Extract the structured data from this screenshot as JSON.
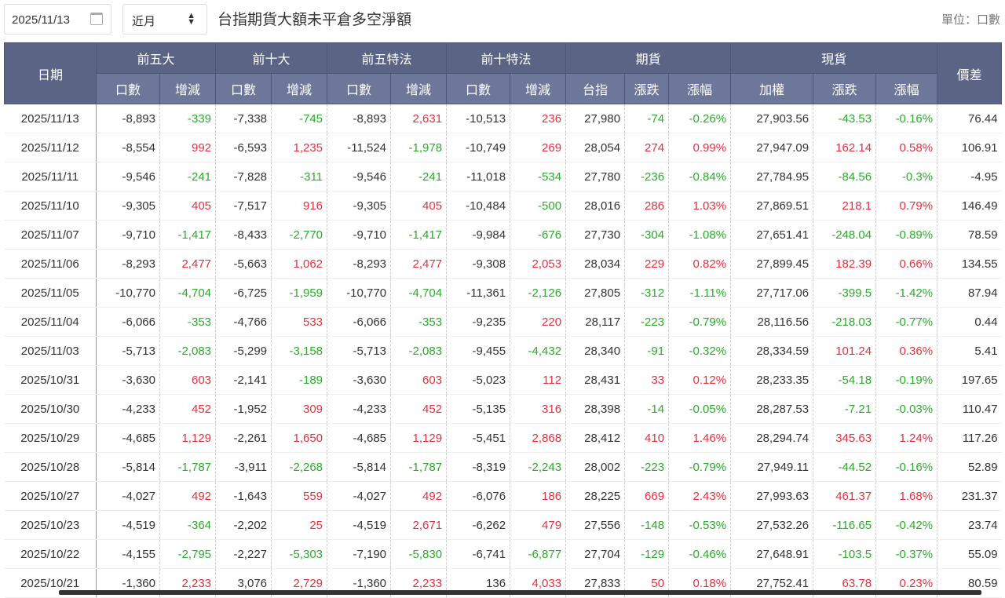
{
  "toolbar": {
    "date": "2025/11/13",
    "contract": "近月",
    "title": "台指期貨大額未平倉多空淨額",
    "unit": "單位：口數"
  },
  "header": {
    "date": "日期",
    "top5": "前五大",
    "top10": "前十大",
    "top5spec": "前五特法",
    "top10spec": "前十特法",
    "futures": "期貨",
    "spot": "現貨",
    "basis": "價差",
    "lots": "口數",
    "change": "增減",
    "taiex_fut": "台指",
    "updown": "漲跌",
    "pct": "漲幅",
    "weighted": "加權"
  },
  "colored_columns": [
    2,
    4,
    6,
    8,
    10,
    11,
    13,
    14
  ],
  "colors": {
    "up": "#e0323c",
    "down": "#2aab2a",
    "header": "#5b6485",
    "subheader": "#6d779a"
  },
  "rows": [
    [
      "2025/11/13",
      "-8,893",
      "-339",
      "-7,338",
      "-745",
      "-8,893",
      "2,631",
      "-10,513",
      "236",
      "27,980",
      "-74",
      "-0.26%",
      "27,903.56",
      "-43.53",
      "-0.16%",
      "76.44"
    ],
    [
      "2025/11/12",
      "-8,554",
      "992",
      "-6,593",
      "1,235",
      "-11,524",
      "-1,978",
      "-10,749",
      "269",
      "28,054",
      "274",
      "0.99%",
      "27,947.09",
      "162.14",
      "0.58%",
      "106.91"
    ],
    [
      "2025/11/11",
      "-9,546",
      "-241",
      "-7,828",
      "-311",
      "-9,546",
      "-241",
      "-11,018",
      "-534",
      "27,780",
      "-236",
      "-0.84%",
      "27,784.95",
      "-84.56",
      "-0.3%",
      "-4.95"
    ],
    [
      "2025/11/10",
      "-9,305",
      "405",
      "-7,517",
      "916",
      "-9,305",
      "405",
      "-10,484",
      "-500",
      "28,016",
      "286",
      "1.03%",
      "27,869.51",
      "218.1",
      "0.79%",
      "146.49"
    ],
    [
      "2025/11/07",
      "-9,710",
      "-1,417",
      "-8,433",
      "-2,770",
      "-9,710",
      "-1,417",
      "-9,984",
      "-676",
      "27,730",
      "-304",
      "-1.08%",
      "27,651.41",
      "-248.04",
      "-0.89%",
      "78.59"
    ],
    [
      "2025/11/06",
      "-8,293",
      "2,477",
      "-5,663",
      "1,062",
      "-8,293",
      "2,477",
      "-9,308",
      "2,053",
      "28,034",
      "229",
      "0.82%",
      "27,899.45",
      "182.39",
      "0.66%",
      "134.55"
    ],
    [
      "2025/11/05",
      "-10,770",
      "-4,704",
      "-6,725",
      "-1,959",
      "-10,770",
      "-4,704",
      "-11,361",
      "-2,126",
      "27,805",
      "-312",
      "-1.11%",
      "27,717.06",
      "-399.5",
      "-1.42%",
      "87.94"
    ],
    [
      "2025/11/04",
      "-6,066",
      "-353",
      "-4,766",
      "533",
      "-6,066",
      "-353",
      "-9,235",
      "220",
      "28,117",
      "-223",
      "-0.79%",
      "28,116.56",
      "-218.03",
      "-0.77%",
      "0.44"
    ],
    [
      "2025/11/03",
      "-5,713",
      "-2,083",
      "-5,299",
      "-3,158",
      "-5,713",
      "-2,083",
      "-9,455",
      "-4,432",
      "28,340",
      "-91",
      "-0.32%",
      "28,334.59",
      "101.24",
      "0.36%",
      "5.41"
    ],
    [
      "2025/10/31",
      "-3,630",
      "603",
      "-2,141",
      "-189",
      "-3,630",
      "603",
      "-5,023",
      "112",
      "28,431",
      "33",
      "0.12%",
      "28,233.35",
      "-54.18",
      "-0.19%",
      "197.65"
    ],
    [
      "2025/10/30",
      "-4,233",
      "452",
      "-1,952",
      "309",
      "-4,233",
      "452",
      "-5,135",
      "316",
      "28,398",
      "-14",
      "-0.05%",
      "28,287.53",
      "-7.21",
      "-0.03%",
      "110.47"
    ],
    [
      "2025/10/29",
      "-4,685",
      "1,129",
      "-2,261",
      "1,650",
      "-4,685",
      "1,129",
      "-5,451",
      "2,868",
      "28,412",
      "410",
      "1.46%",
      "28,294.74",
      "345.63",
      "1.24%",
      "117.26"
    ],
    [
      "2025/10/28",
      "-5,814",
      "-1,787",
      "-3,911",
      "-2,268",
      "-5,814",
      "-1,787",
      "-8,319",
      "-2,243",
      "28,002",
      "-223",
      "-0.79%",
      "27,949.11",
      "-44.52",
      "-0.16%",
      "52.89"
    ],
    [
      "2025/10/27",
      "-4,027",
      "492",
      "-1,643",
      "559",
      "-4,027",
      "492",
      "-6,076",
      "186",
      "28,225",
      "669",
      "2.43%",
      "27,993.63",
      "461.37",
      "1.68%",
      "231.37"
    ],
    [
      "2025/10/23",
      "-4,519",
      "-364",
      "-2,202",
      "25",
      "-4,519",
      "2,671",
      "-6,262",
      "479",
      "27,556",
      "-148",
      "-0.53%",
      "27,532.26",
      "-116.65",
      "-0.42%",
      "23.74"
    ],
    [
      "2025/10/22",
      "-4,155",
      "-2,795",
      "-2,227",
      "-5,303",
      "-7,190",
      "-5,830",
      "-6,741",
      "-6,877",
      "27,704",
      "-129",
      "-0.46%",
      "27,648.91",
      "-103.5",
      "-0.37%",
      "55.09"
    ],
    [
      "2025/10/21",
      "-1,360",
      "2,233",
      "3,076",
      "2,729",
      "-1,360",
      "2,233",
      "136",
      "4,033",
      "27,833",
      "50",
      "0.18%",
      "27,752.41",
      "63.78",
      "0.23%",
      "80.59"
    ]
  ]
}
